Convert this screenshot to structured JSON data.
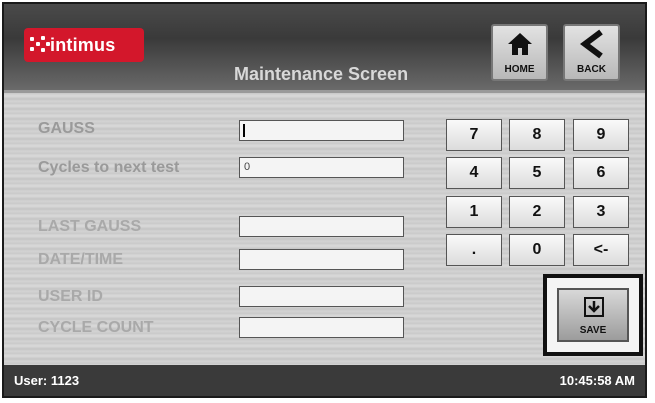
{
  "header": {
    "logo_text": "intimus",
    "title": "Maintenance Screen",
    "home_label": "HOME",
    "back_label": "BACK"
  },
  "form": {
    "gauss_label": "GAUSS",
    "gauss_value": "",
    "cycles_label": "Cycles to next test",
    "cycles_value": "0",
    "last_gauss_label": "LAST GAUSS",
    "last_gauss_value": "",
    "datetime_label": "DATE/TIME",
    "datetime_value": "",
    "userid_label": "USER ID",
    "userid_value": "",
    "cyclecount_label": "CYCLE COUNT",
    "cyclecount_value": ""
  },
  "keypad": {
    "keys": [
      "7",
      "8",
      "9",
      "4",
      "5",
      "6",
      "1",
      "2",
      "3",
      ".",
      "0",
      "<-"
    ]
  },
  "save_label": "SAVE",
  "status": {
    "user": "User: 1123",
    "time": "10:45:58 AM"
  },
  "colors": {
    "brand_red": "#d3172b",
    "active_label": "#9a9a9a",
    "dim_label": "#a9a9a9"
  }
}
